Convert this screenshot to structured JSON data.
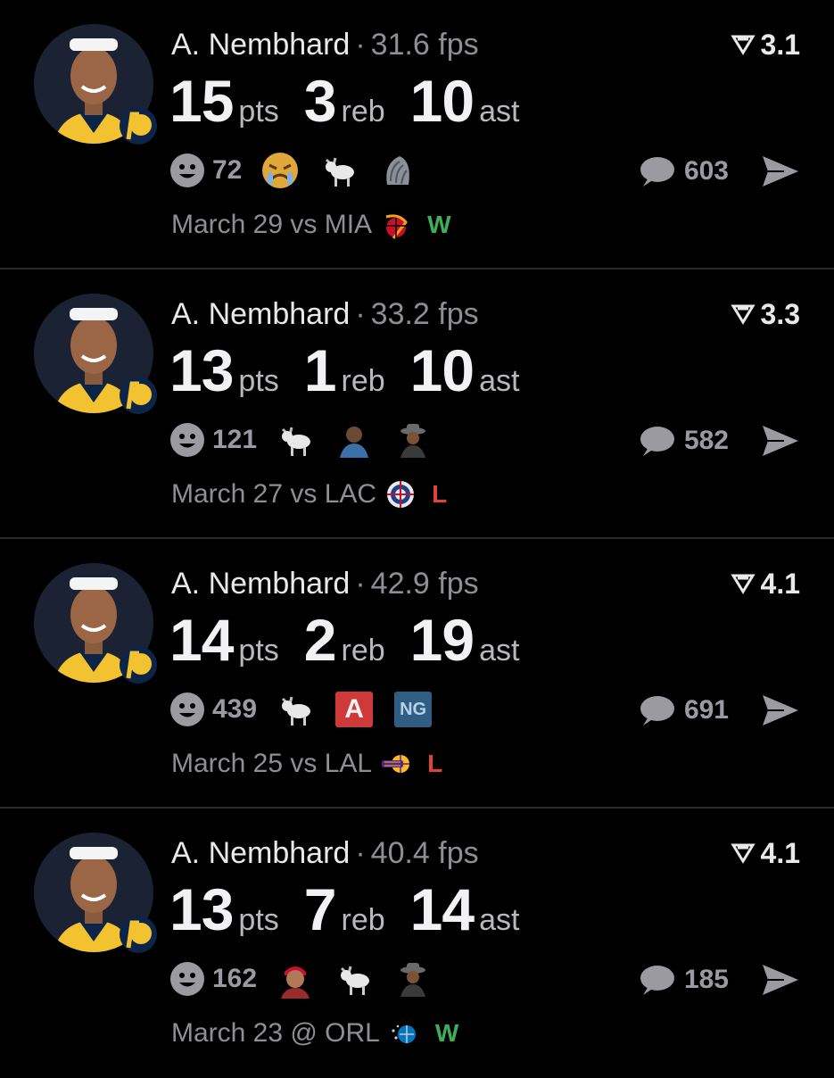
{
  "colors": {
    "background": "#000000",
    "win": "#3fae5a",
    "loss": "#e0413a",
    "muted": "#8e8e93"
  },
  "cards": [
    {
      "player": "A. Nembhard",
      "separator": "·",
      "fps": "31.6 fps",
      "score": "3.1",
      "pts": "15",
      "pts_label": "pts",
      "reb": "3",
      "reb_label": "reb",
      "ast": "10",
      "ast_label": "ast",
      "reactions": "72",
      "emojis": [
        "crying-face-emoji",
        "goat-emoji",
        "shell-emoji"
      ],
      "comments": "603",
      "game": "March 29 vs MIA",
      "opponent_logo": "heat-logo",
      "result": "W"
    },
    {
      "player": "A. Nembhard",
      "separator": "·",
      "fps": "33.2 fps",
      "score": "3.3",
      "pts": "13",
      "pts_label": "pts",
      "reb": "1",
      "reb_label": "reb",
      "ast": "10",
      "ast_label": "ast",
      "reactions": "121",
      "emojis": [
        "goat-emoji",
        "player-avatar-emoji",
        "cowboy-avatar-emoji"
      ],
      "comments": "582",
      "game": "March 27 vs LAC",
      "opponent_logo": "clippers-logo",
      "result": "L"
    },
    {
      "player": "A. Nembhard",
      "separator": "·",
      "fps": "42.9 fps",
      "score": "4.1",
      "pts": "14",
      "pts_label": "pts",
      "reb": "2",
      "reb_label": "reb",
      "ast": "19",
      "ast_label": "ast",
      "reactions": "439",
      "emojis": [
        "goat-emoji",
        "a-badge-emoji",
        "ng-badge-emoji"
      ],
      "badge_a": "A",
      "badge_ng": "NG",
      "comments": "691",
      "game": "March 25 vs LAL",
      "opponent_logo": "lakers-logo",
      "result": "L"
    },
    {
      "player": "A. Nembhard",
      "separator": "·",
      "fps": "40.4 fps",
      "score": "4.1",
      "pts": "13",
      "pts_label": "pts",
      "reb": "7",
      "reb_label": "reb",
      "ast": "14",
      "ast_label": "ast",
      "reactions": "162",
      "emojis": [
        "player-avatar-emoji",
        "goat-emoji",
        "cowboy-avatar-emoji"
      ],
      "comments": "185",
      "game": "March 23 @ ORL",
      "opponent_logo": "magic-logo",
      "result": "W"
    }
  ]
}
